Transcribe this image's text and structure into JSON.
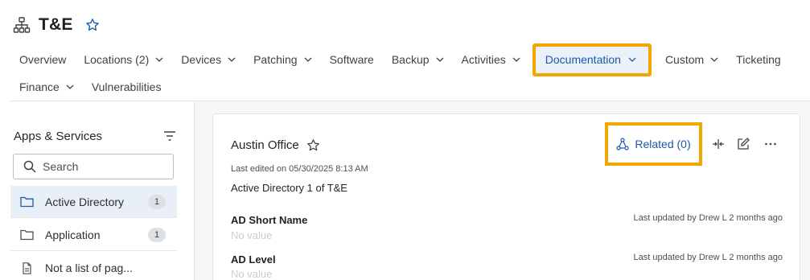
{
  "header": {
    "title": "T&E",
    "icon": "org-hierarchy-icon",
    "favorite_icon": "star-outline-icon"
  },
  "tabs": {
    "row1": [
      {
        "label": "Overview",
        "dropdown": false
      },
      {
        "label": "Locations (2)",
        "dropdown": true
      },
      {
        "label": "Devices",
        "dropdown": true
      },
      {
        "label": "Patching",
        "dropdown": true
      },
      {
        "label": "Software",
        "dropdown": false
      },
      {
        "label": "Backup",
        "dropdown": true
      },
      {
        "label": "Activities",
        "dropdown": true
      },
      {
        "label": "Documentation",
        "dropdown": true,
        "active": true
      },
      {
        "label": "Custom",
        "dropdown": true
      },
      {
        "label": "Ticketing",
        "dropdown": false
      }
    ],
    "row2": [
      {
        "label": "Finance",
        "dropdown": true
      },
      {
        "label": "Vulnerabilities",
        "dropdown": false
      }
    ]
  },
  "sidebar": {
    "title": "Apps & Services",
    "search_placeholder": "Search",
    "items": [
      {
        "label": "Active Directory",
        "count": "1",
        "icon": "folder-icon",
        "active": true
      },
      {
        "label": "Application",
        "count": "1",
        "icon": "folder-icon",
        "active": false
      },
      {
        "label": "Not a list of pag...",
        "count": "",
        "icon": "document-icon",
        "active": false
      }
    ]
  },
  "record": {
    "title": "Austin Office",
    "edited": "Last edited on 05/30/2025 8:13 AM",
    "subtitle": "Active Directory 1 of T&E",
    "related_label": "Related (0)",
    "actions": [
      "split-view-icon",
      "edit-icon",
      "more-icon"
    ],
    "fields": [
      {
        "label": "AD Short Name",
        "value": "No value",
        "meta": "Last updated by Drew L 2 months ago"
      },
      {
        "label": "AD Level",
        "value": "No value",
        "meta": "Last updated by Drew L 2 months ago"
      }
    ]
  },
  "colors": {
    "accent": "#1c5aa6",
    "highlight": "#f2a600",
    "active_tab_bg": "#eaf1fb"
  }
}
